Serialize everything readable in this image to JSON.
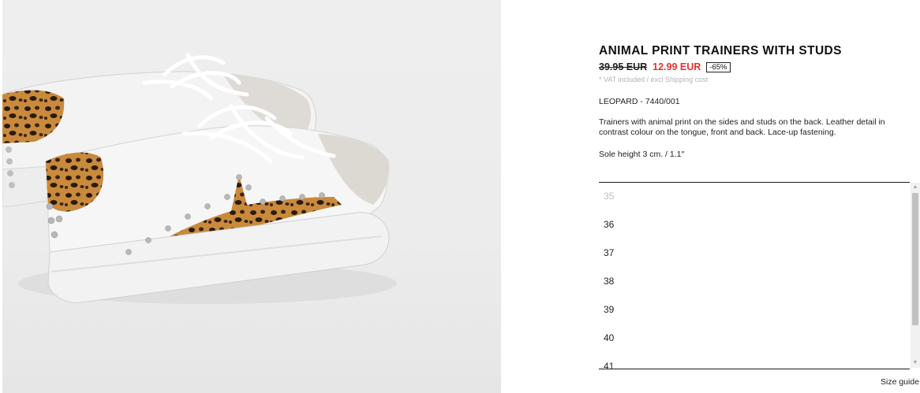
{
  "product": {
    "title": "ANIMAL PRINT TRAINERS WITH STUDS",
    "old_price": "39.95 EUR",
    "sale_price": "12.99 EUR",
    "discount": "-65%",
    "vat_note": "* VAT included / excl Shipping cost",
    "colour_ref": "LEOPARD - 7440/001",
    "description": "Trainers with animal print on the sides and studs on the back. Leather detail in contrast colour on the tongue, front and back. Lace-up fastening.",
    "sole_height": "Sole height 3 cm. / 1.1″"
  },
  "sizes": [
    {
      "label": "35",
      "available": false
    },
    {
      "label": "36",
      "available": true
    },
    {
      "label": "37",
      "available": true
    },
    {
      "label": "38",
      "available": true
    },
    {
      "label": "39",
      "available": true
    },
    {
      "label": "40",
      "available": true
    },
    {
      "label": "41",
      "available": true
    }
  ],
  "scrollbar": {
    "up_icon": "triangle-up-icon",
    "down_icon": "triangle-down-icon"
  },
  "size_guide_label": "Size guide",
  "colors": {
    "sale_price": "#e5312b",
    "unavailable_size": "#bdbdbd",
    "image_background": "#eeeeee"
  }
}
